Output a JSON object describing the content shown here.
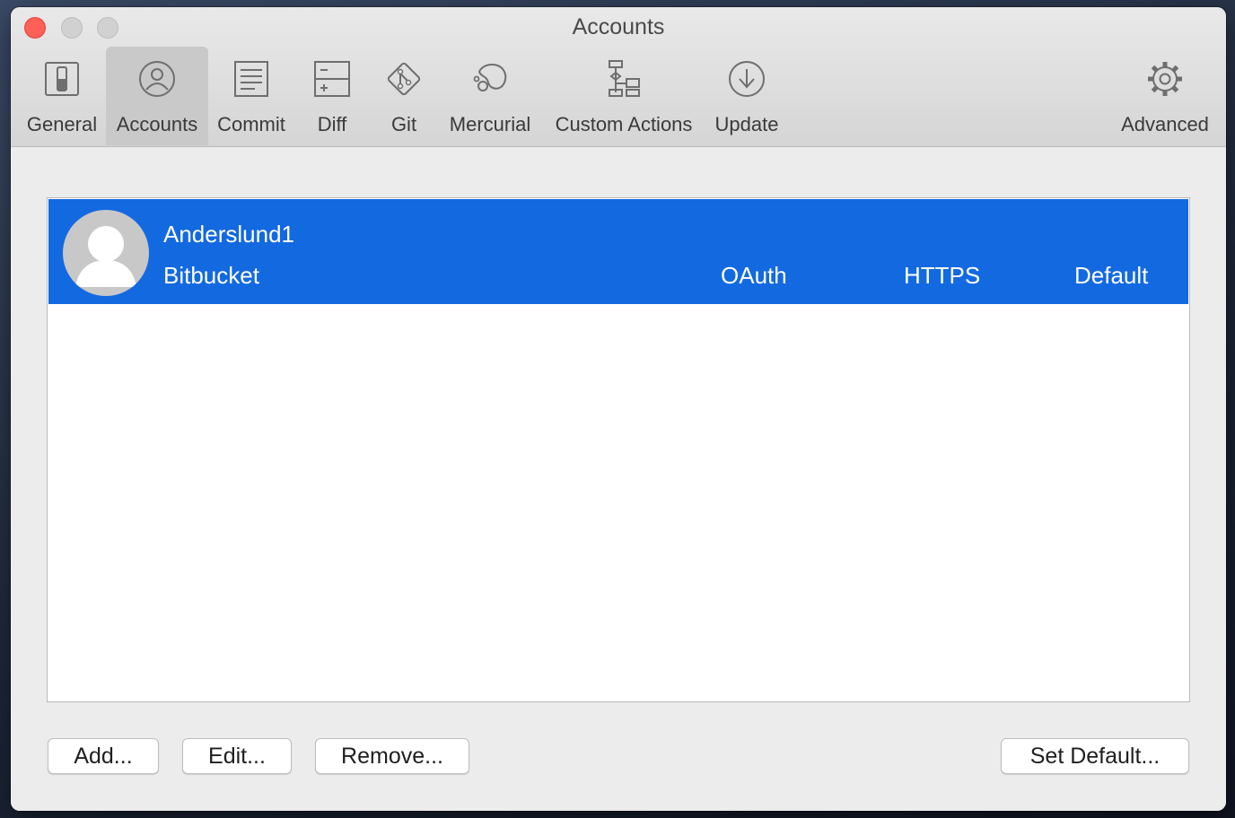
{
  "window": {
    "title": "Accounts"
  },
  "toolbar": {
    "items": [
      {
        "label": "General",
        "icon": "general-switch-icon"
      },
      {
        "label": "Accounts",
        "icon": "person-circle-icon",
        "selected": true
      },
      {
        "label": "Commit",
        "icon": "document-lines-icon"
      },
      {
        "label": "Diff",
        "icon": "diff-icon"
      },
      {
        "label": "Git",
        "icon": "git-diamond-icon"
      },
      {
        "label": "Mercurial",
        "icon": "mercurial-icon"
      },
      {
        "label": "Custom Actions",
        "icon": "flowchart-icon"
      },
      {
        "label": "Update",
        "icon": "download-arrow-icon"
      },
      {
        "label": "Advanced",
        "icon": "gear-icon"
      }
    ]
  },
  "accounts": [
    {
      "username": "Anderslund1",
      "host": "Bitbucket",
      "auth": "OAuth",
      "protocol": "HTTPS",
      "status": "Default",
      "selected": true
    }
  ],
  "buttons": {
    "add": "Add...",
    "edit": "Edit...",
    "remove": "Remove...",
    "set_default": "Set Default..."
  },
  "colors": {
    "selection": "#1369e0",
    "close_button": "#fe5f57"
  }
}
